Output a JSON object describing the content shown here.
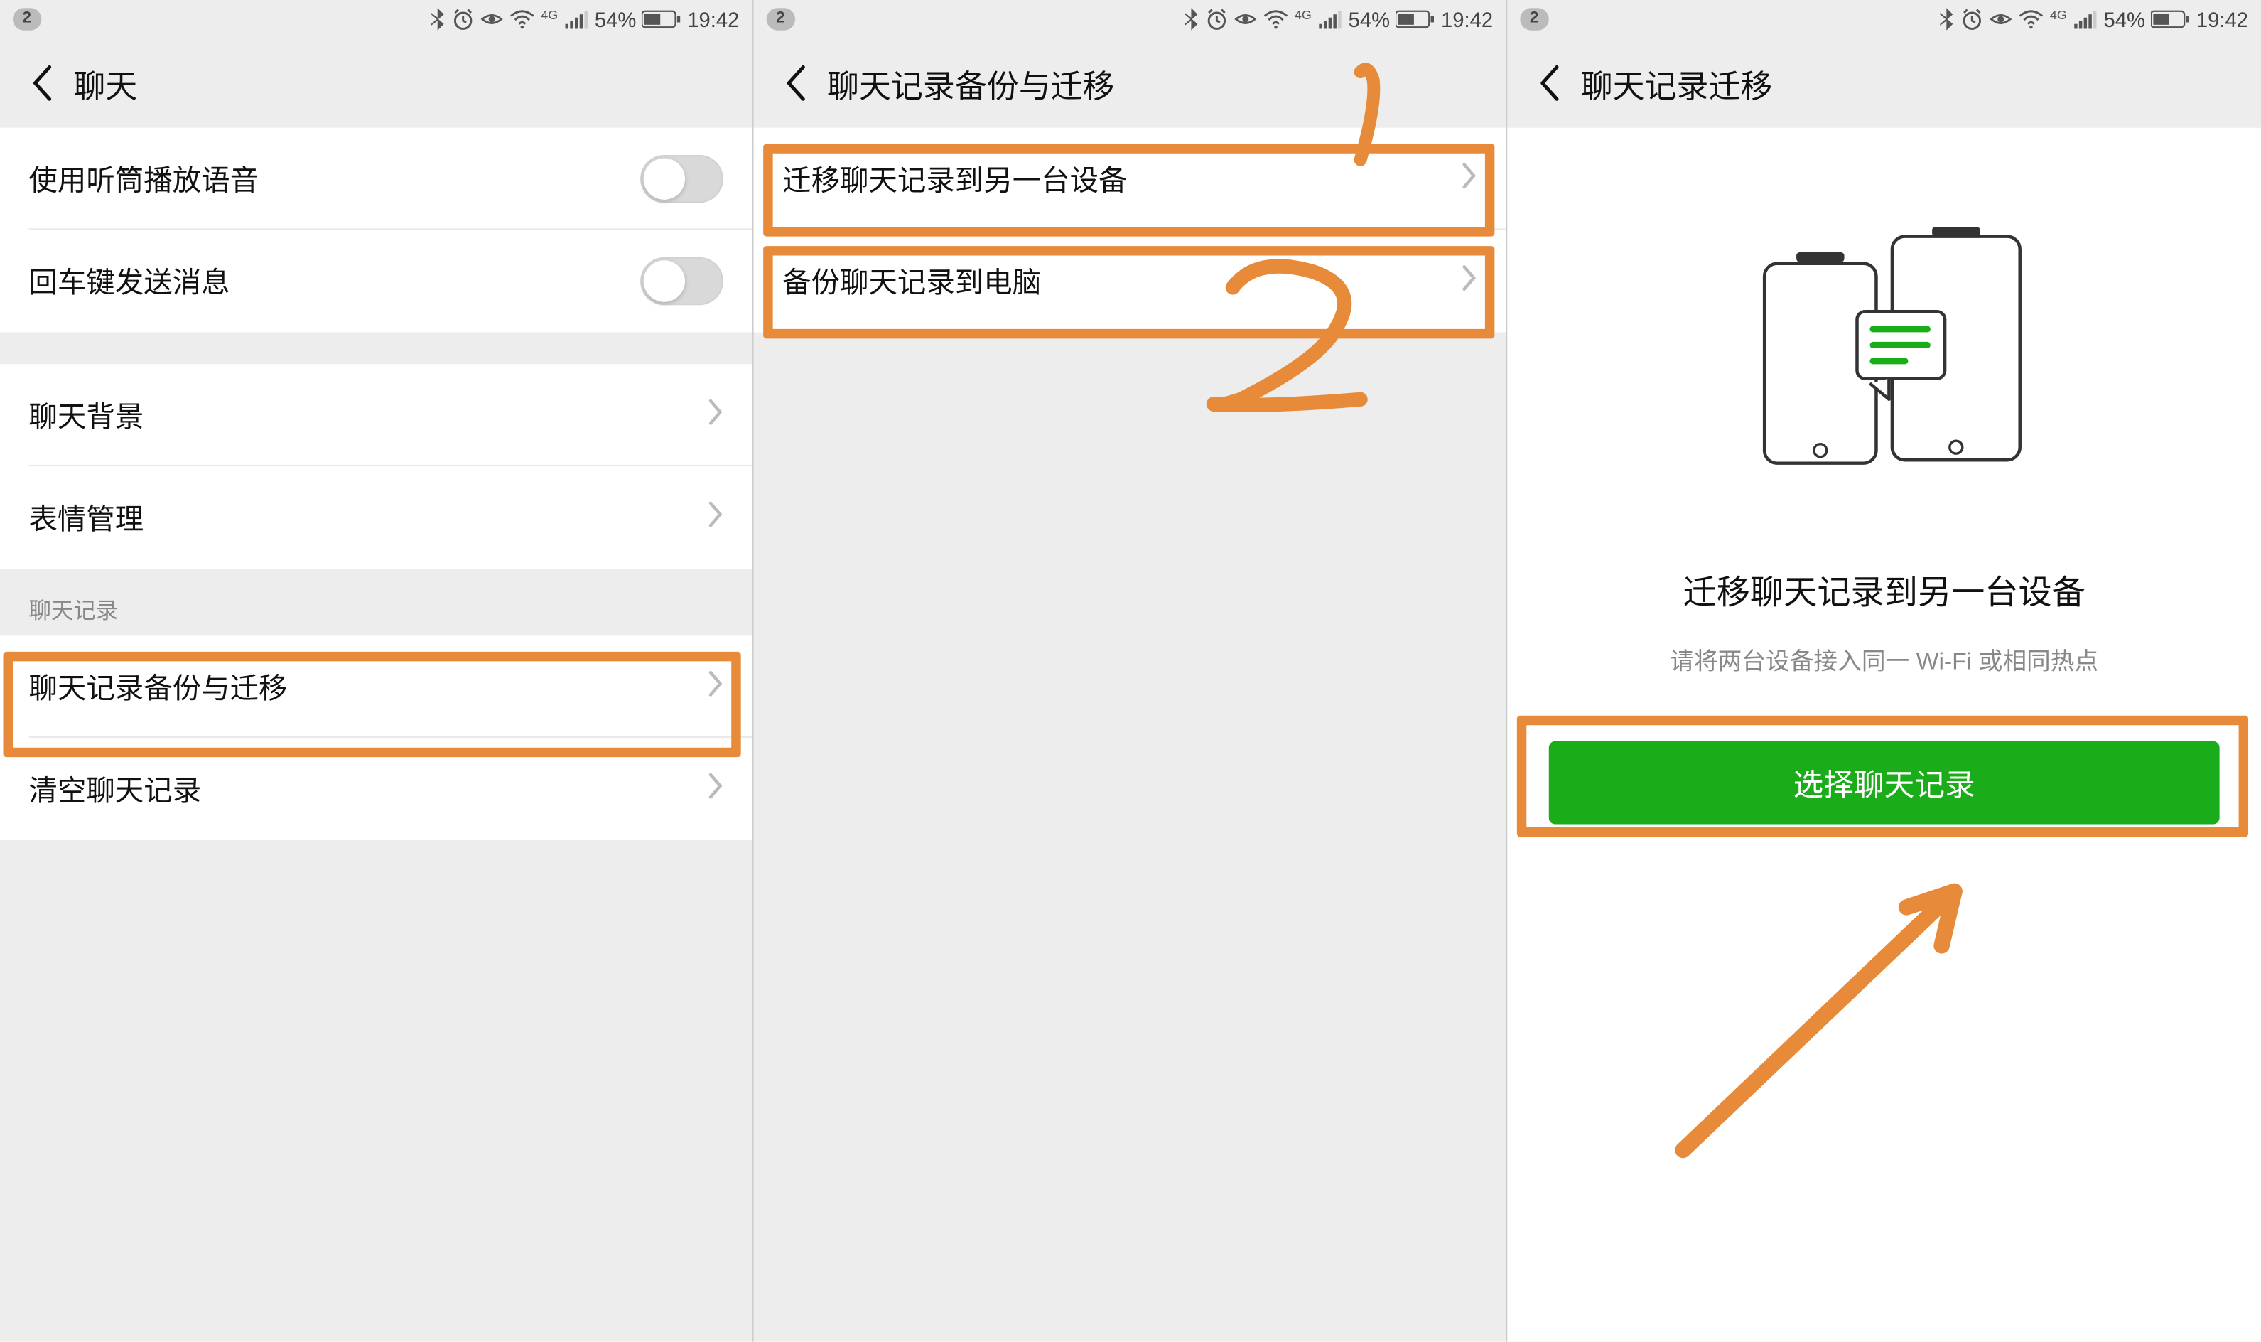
{
  "statusbar": {
    "notif_count": "2",
    "network_label": "4G",
    "battery_pct": "54%",
    "time": "19:42"
  },
  "panel1": {
    "title": "聊天",
    "rows": {
      "r1": "使用听筒播放语音",
      "r2": "回车键发送消息",
      "r3": "聊天背景",
      "r4": "表情管理"
    },
    "section_label": "聊天记录",
    "rows2": {
      "r5": "聊天记录备份与迁移",
      "r6": "清空聊天记录"
    }
  },
  "panel2": {
    "title": "聊天记录备份与迁移",
    "rows": {
      "r1": "迁移聊天记录到另一台设备",
      "r2": "备份聊天记录到电脑"
    },
    "annotations": {
      "mark1": "1",
      "mark2": "2"
    }
  },
  "panel3": {
    "title": "聊天记录迁移",
    "content_title": "迁移聊天记录到另一台设备",
    "content_sub": "请将两台设备接入同一 Wi-Fi 或相同热点",
    "button": "选择聊天记录"
  }
}
